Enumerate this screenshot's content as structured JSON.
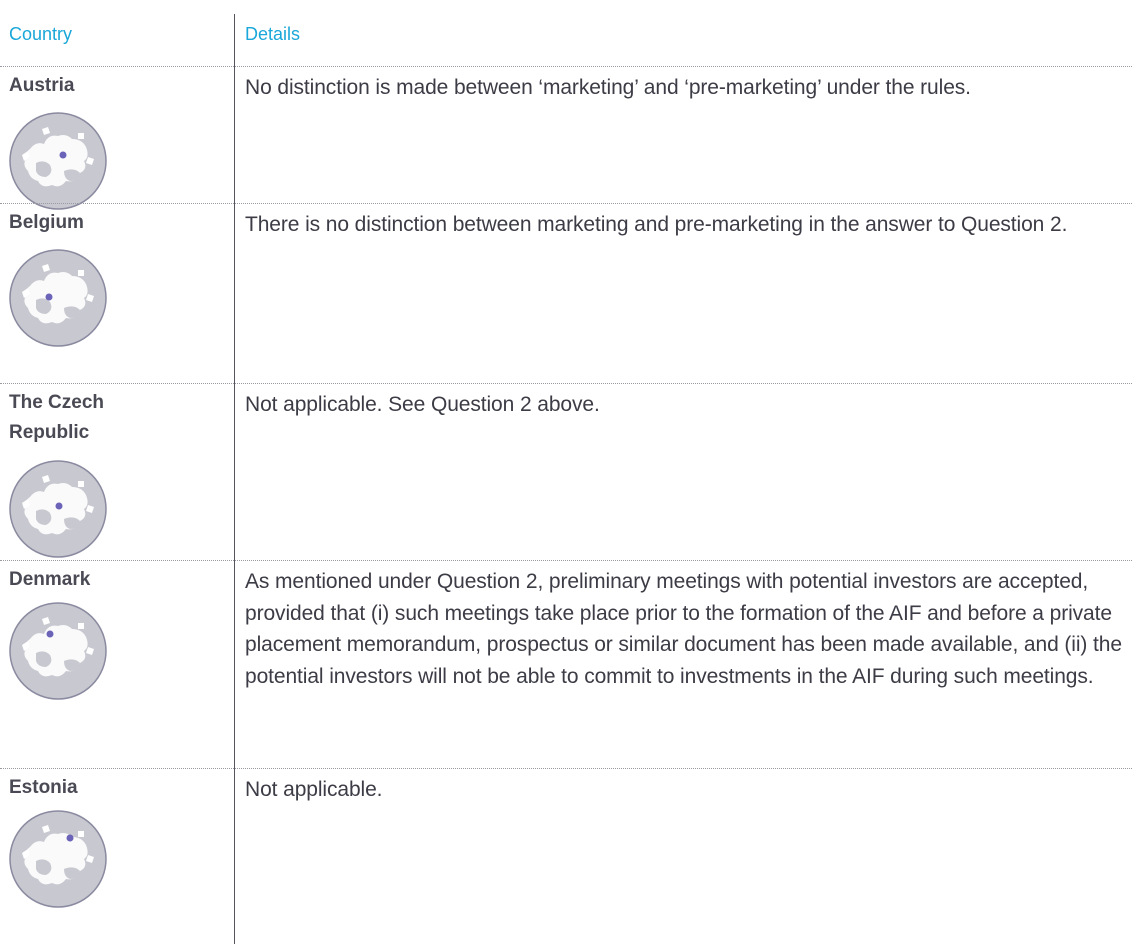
{
  "header": {
    "country": "Country",
    "details": "Details"
  },
  "rows": [
    {
      "country": "Austria",
      "details": "No distinction is made between ‘marketing’ and ‘pre-marketing’ under the rules.",
      "icon": "europe-globe-icon"
    },
    {
      "country": "Belgium",
      "details": "There is no distinction between marketing and pre-marketing in the answer to Question 2.",
      "icon": "europe-globe-icon"
    },
    {
      "country": "The Czech Republic",
      "details": "Not applicable. See Question 2 above.",
      "icon": "europe-globe-icon"
    },
    {
      "country": "Denmark",
      "details": "As mentioned under Question 2, preliminary meetings with potential investors are accepted, provided that (i) such meetings take place prior to the formation of the AIF and before a private placement memorandum, prospectus or similar document has been made available, and (ii) the potential investors will not be able to commit to investments in the AIF during such meetings.",
      "icon": "europe-globe-icon"
    },
    {
      "country": "Estonia",
      "details": "Not applicable.",
      "icon": "europe-globe-icon"
    }
  ],
  "colors": {
    "header_text": "#1aa7d9",
    "globe_fill": "#c8c8d0",
    "globe_dot": "#6a63b8"
  }
}
